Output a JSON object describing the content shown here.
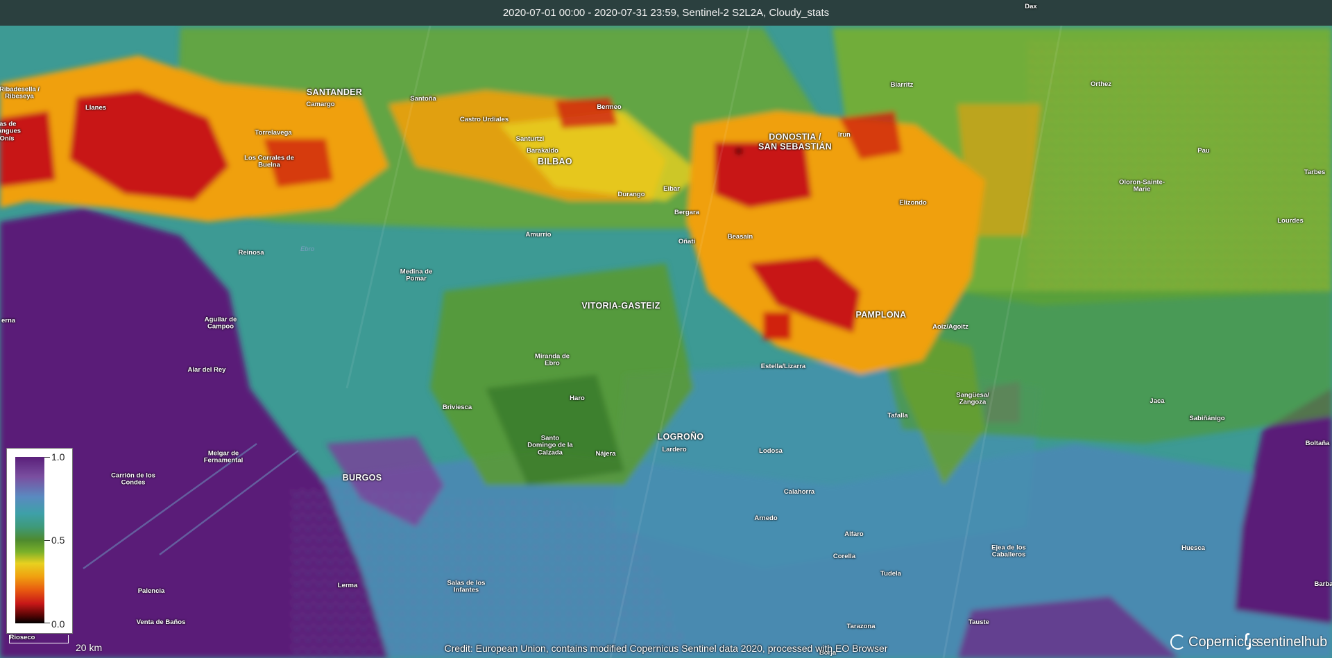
{
  "header": {
    "title": "2020-07-01 00:00 - 2020-07-31 23:59, Sentinel-2 S2L2A, Cloudy_stats"
  },
  "legend": {
    "max_label": "1.0",
    "mid_label": "0.5",
    "min_label": "0.0",
    "colors": [
      "#5a1f7a",
      "#5a8ac0",
      "#3ea0a8",
      "#4e8a2e",
      "#e8d020",
      "#f0a010",
      "#c81818",
      "#000000"
    ]
  },
  "scale": {
    "label": "20 km"
  },
  "credit": "Credit: European Union, contains modified Copernicus Sentinel data 2020, processed with EO Browser",
  "logos": {
    "copernicus": "Copernicus",
    "sentinelhub": "sentinelhub"
  },
  "map": {
    "places": [
      {
        "id": "ribadesella",
        "name": "Ribadesella /\nRibeseya",
        "major": false
      },
      {
        "id": "llanes",
        "name": "Llanes",
        "major": false
      },
      {
        "id": "cangues",
        "name": "jas de\nCangues\nOnís",
        "major": false
      },
      {
        "id": "santander",
        "name": "SANTANDER",
        "major": true
      },
      {
        "id": "camargo",
        "name": "Camargo",
        "major": false
      },
      {
        "id": "torrelavega",
        "name": "Torrelavega",
        "major": false
      },
      {
        "id": "corrales",
        "name": "Los Corrales de\nBuelna",
        "major": false
      },
      {
        "id": "santona",
        "name": "Santoña",
        "major": false
      },
      {
        "id": "castro",
        "name": "Castro Urdiales",
        "major": false
      },
      {
        "id": "bermeo",
        "name": "Bermeo",
        "major": false
      },
      {
        "id": "santurtzi",
        "name": "Santurtzi",
        "major": false
      },
      {
        "id": "barakaldo",
        "name": "Barakaldo",
        "major": false
      },
      {
        "id": "bilbao",
        "name": "BILBAO",
        "major": true
      },
      {
        "id": "durango",
        "name": "Durango",
        "major": false
      },
      {
        "id": "eibar",
        "name": "Eibar",
        "major": false
      },
      {
        "id": "bergara",
        "name": "Bergara",
        "major": false
      },
      {
        "id": "onati",
        "name": "Oñati",
        "major": false
      },
      {
        "id": "donostia",
        "name": "DONOSTIA /\nSAN SEBASTIÁN",
        "major": true
      },
      {
        "id": "irun",
        "name": "Irun",
        "major": false
      },
      {
        "id": "biarritz",
        "name": "Biarritz",
        "major": false
      },
      {
        "id": "beasain",
        "name": "Beasain",
        "major": false
      },
      {
        "id": "elizondo",
        "name": "Elizondo",
        "major": false
      },
      {
        "id": "orthez",
        "name": "Orthez",
        "major": false
      },
      {
        "id": "pau",
        "name": "Pau",
        "major": false
      },
      {
        "id": "tarbes",
        "name": "Tarbes",
        "major": false
      },
      {
        "id": "oloron",
        "name": "Oloron-Sainte-\nMarie",
        "major": false
      },
      {
        "id": "lourdes",
        "name": "Lourdes",
        "major": false
      },
      {
        "id": "reinosa",
        "name": "Reinosa",
        "major": false
      },
      {
        "id": "ebro",
        "name": "Ebro",
        "major": false,
        "river": true
      },
      {
        "id": "amurrio",
        "name": "Amurrio",
        "major": false
      },
      {
        "id": "medina",
        "name": "Medina de\nPomar",
        "major": false
      },
      {
        "id": "vitoria",
        "name": "VITORIA-GASTEIZ",
        "major": true
      },
      {
        "id": "pamplona",
        "name": "PAMPLONA",
        "major": true
      },
      {
        "id": "aoiz",
        "name": "Aoiz/Agoitz",
        "major": false
      },
      {
        "id": "nerna",
        "name": "erna",
        "major": false
      },
      {
        "id": "aguilar",
        "name": "Aguilar de\nCampoo",
        "major": false
      },
      {
        "id": "alar",
        "name": "Alar del Rey",
        "major": false
      },
      {
        "id": "miranda",
        "name": "Miranda de\nEbro",
        "major": false
      },
      {
        "id": "estella",
        "name": "Estella/Lizarra",
        "major": false
      },
      {
        "id": "haro",
        "name": "Haro",
        "major": false
      },
      {
        "id": "briviesca",
        "name": "Briviesca",
        "major": false
      },
      {
        "id": "tafalla",
        "name": "Tafalla",
        "major": false
      },
      {
        "id": "sanguesa",
        "name": "Sangüesa/\nZangoza",
        "major": false
      },
      {
        "id": "jaca",
        "name": "Jaca",
        "major": false
      },
      {
        "id": "sabinanigo",
        "name": "Sabiñánigo",
        "major": false
      },
      {
        "id": "santodomingo",
        "name": "Santo\nDomingo de la\nCalzada",
        "major": false
      },
      {
        "id": "logrono",
        "name": "LOGROÑO",
        "major": true
      },
      {
        "id": "lardero",
        "name": "Lardero",
        "major": false
      },
      {
        "id": "najera",
        "name": "Nájera",
        "major": false
      },
      {
        "id": "lodosa",
        "name": "Lodosa",
        "major": false
      },
      {
        "id": "boltana",
        "name": "Boltaña",
        "major": false
      },
      {
        "id": "melgar",
        "name": "Melgar de\nFernamental",
        "major": false
      },
      {
        "id": "carrion",
        "name": "Carrión de los\nCondes",
        "major": false
      },
      {
        "id": "burgos",
        "name": "BURGOS",
        "major": true
      },
      {
        "id": "calahorra",
        "name": "Calahorra",
        "major": false
      },
      {
        "id": "arnedo",
        "name": "Arnedo",
        "major": false
      },
      {
        "id": "alfaro",
        "name": "Alfaro",
        "major": false
      },
      {
        "id": "corella",
        "name": "Corella",
        "major": false
      },
      {
        "id": "ejea",
        "name": "Ejea de los\nCaballeros",
        "major": false
      },
      {
        "id": "huesca",
        "name": "Huesca",
        "major": false
      },
      {
        "id": "palencia",
        "name": "Palencia",
        "major": false
      },
      {
        "id": "lerma",
        "name": "Lerma",
        "major": false
      },
      {
        "id": "salas",
        "name": "Salas de los\nInfantes",
        "major": false
      },
      {
        "id": "tudela",
        "name": "Tudela",
        "major": false
      },
      {
        "id": "barba",
        "name": "Barba",
        "major": false
      },
      {
        "id": "ventadebanos",
        "name": "Venta de Baños",
        "major": false
      },
      {
        "id": "tarazona",
        "name": "Tarazona",
        "major": false
      },
      {
        "id": "tauste",
        "name": "Tauste",
        "major": false
      },
      {
        "id": "rioseco",
        "name": "Rioseco",
        "major": false
      },
      {
        "id": "borja",
        "name": "Borja",
        "major": false
      },
      {
        "id": "dax",
        "name": "Dax",
        "major": false
      }
    ]
  }
}
